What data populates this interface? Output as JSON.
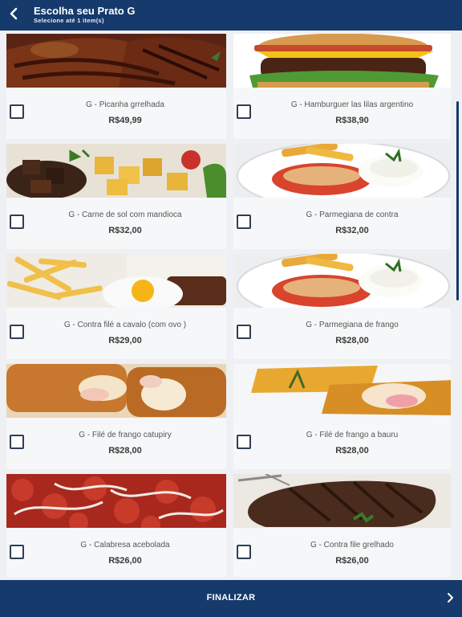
{
  "header": {
    "title": "Escolha seu Prato G",
    "subtitle": "Selecione até 1 item(s)"
  },
  "items": [
    {
      "name": "G - Picanha grrelhada",
      "price": "R$49,99",
      "image": "grilled-picanha"
    },
    {
      "name": "G - Hamburguer las lilas argentino",
      "price": "R$38,90",
      "image": "hamburger"
    },
    {
      "name": "G - Carne de sol com mandioca",
      "price": "R$32,00",
      "image": "carne-de-sol-mandioca"
    },
    {
      "name": "G - Parmegiana de contra",
      "price": "R$32,00",
      "image": "parmegiana-plate"
    },
    {
      "name": "G - Contra filé a cavalo (com ovo )",
      "price": "R$29,00",
      "image": "steak-with-egg"
    },
    {
      "name": "G - Parmegiana de frango",
      "price": "R$28,00",
      "image": "parmegiana-plate"
    },
    {
      "name": "G - Filé de frango catupiry",
      "price": "R$28,00",
      "image": "breaded-chicken"
    },
    {
      "name": "G - Filé de frango a bauru",
      "price": "R$28,00",
      "image": "breaded-chicken-bauru"
    },
    {
      "name": "G - Calabresa acebolada",
      "price": "R$26,00",
      "image": "calabresa-onions"
    },
    {
      "name": "G - Contra file grelhado",
      "price": "R$26,00",
      "image": "grilled-steak"
    }
  ],
  "footer": {
    "label": "FINALIZAR"
  },
  "colors": {
    "brand": "#153a6b",
    "card": "#f6f7f8",
    "background": "#eef0f3"
  }
}
